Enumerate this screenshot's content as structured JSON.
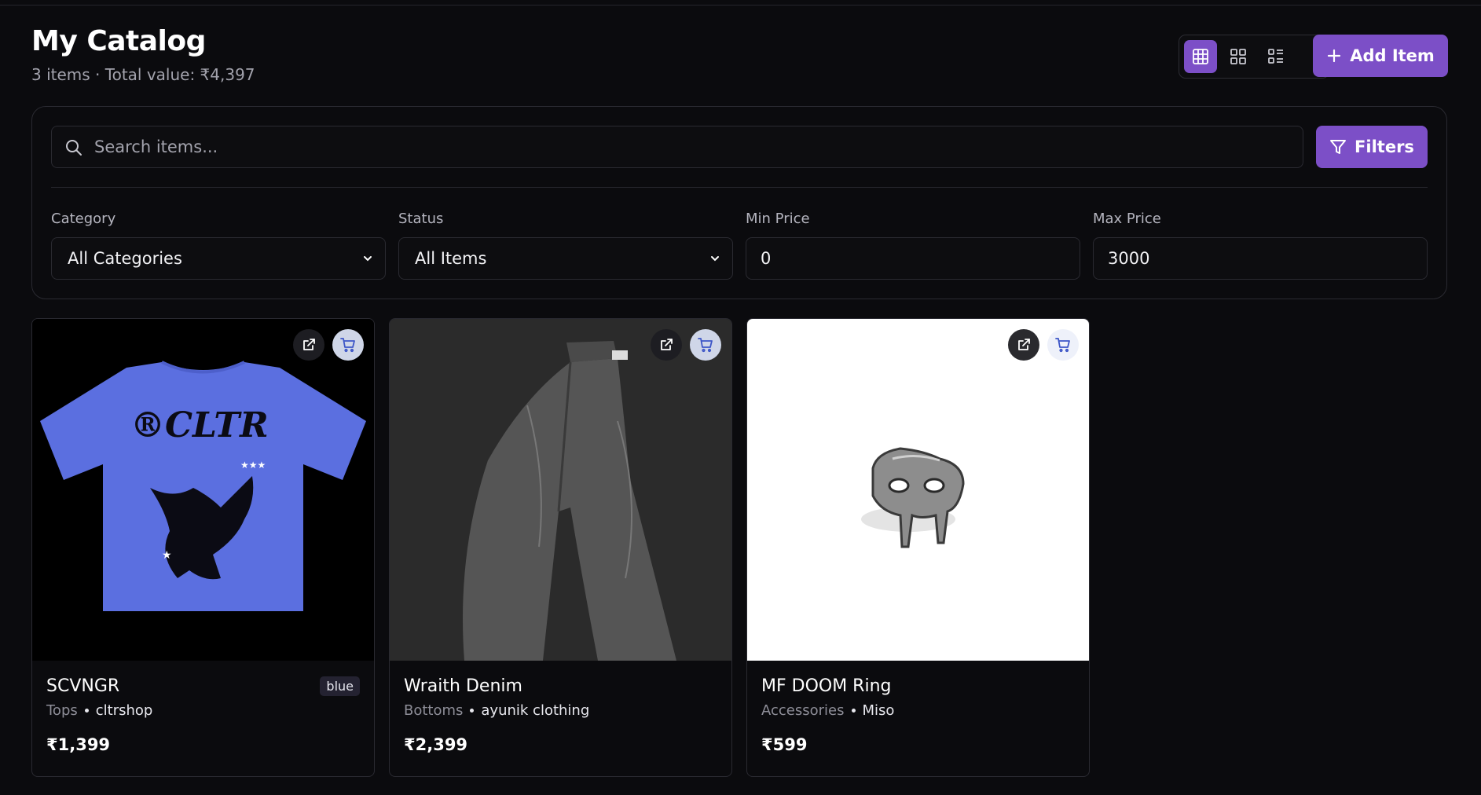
{
  "header": {
    "title": "My Catalog",
    "subtitle": "3 items · Total value: ₹4,397",
    "add_button_label": "Add Item"
  },
  "view_modes": [
    "table-grid",
    "grid",
    "list"
  ],
  "search": {
    "placeholder": "Search items...",
    "value": ""
  },
  "filters_button_label": "Filters",
  "filters": {
    "category": {
      "label": "Category",
      "value": "All Categories"
    },
    "status": {
      "label": "Status",
      "value": "All Items"
    },
    "min_price": {
      "label": "Min Price",
      "value": "0"
    },
    "max_price": {
      "label": "Max Price",
      "value": "3000"
    }
  },
  "items": [
    {
      "name": "SCVNGR",
      "category": "Tops",
      "store": "cltrshop",
      "price": "₹1,399",
      "tag": "blue"
    },
    {
      "name": "Wraith Denim",
      "category": "Bottoms",
      "store": "ayunik clothing",
      "price": "₹2,399",
      "tag": ""
    },
    {
      "name": "MF DOOM Ring",
      "category": "Accessories",
      "store": "Miso",
      "price": "₹599",
      "tag": ""
    }
  ],
  "colors": {
    "accent": "#7c4fc7",
    "background": "#0b0b0e",
    "tshirt": "#5b6fe0"
  }
}
